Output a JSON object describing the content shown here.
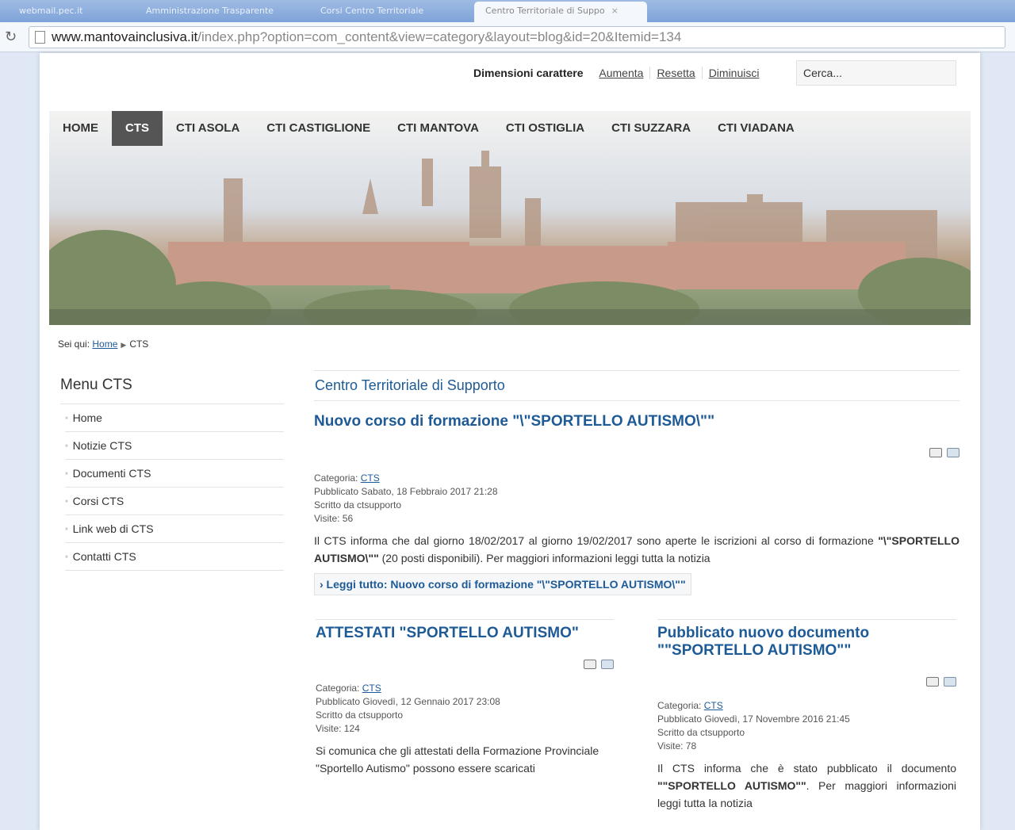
{
  "browser": {
    "tabs": [
      {
        "label": "webmail.pec.it"
      },
      {
        "label": "Amministrazione Trasparente"
      },
      {
        "label": "Corsi Centro Territoriale"
      },
      {
        "label": "Centro Territoriale di Suppo",
        "close": "×"
      }
    ],
    "url_host": "www.mantovainclusiva.it",
    "url_rest": "/index.php?option=com_content&view=category&layout=blog&id=20&Itemid=134"
  },
  "font_controls": {
    "label": "Dimensioni carattere",
    "increase": "Aumenta",
    "reset": "Resetta",
    "decrease": "Diminuisci"
  },
  "search": {
    "placeholder": "Cerca..."
  },
  "nav": {
    "items": [
      "HOME",
      "CTS",
      "CTI ASOLA",
      "CTI CASTIGLIONE",
      "CTI MANTOVA",
      "CTI OSTIGLIA",
      "CTI SUZZARA",
      "CTI VIADANA"
    ],
    "active": "CTS"
  },
  "breadcrumb": {
    "prefix": "Sei qui:",
    "home": "Home",
    "current": "CTS"
  },
  "sidebar": {
    "title": "Menu CTS",
    "items": [
      "Home",
      "Notizie CTS",
      "Documenti CTS",
      "Corsi CTS",
      "Link web di CTS",
      "Contatti CTS"
    ]
  },
  "main": {
    "category_title": "Centro Territoriale di Supporto",
    "lead": {
      "title": "Nuovo corso di formazione \"\\\"SPORTELLO AUTISMO\\\"\"",
      "category_label": "Categoria:",
      "category": "CTS",
      "published": "Pubblicato Sabato, 18 Febbraio 2017 21:28",
      "author": "Scritto da ctsupporto",
      "visits": "Visite: 56",
      "body_a": "Il CTS informa che dal giorno 18/02/2017 al giorno 19/02/2017 sono aperte le iscrizioni al corso di formazione ",
      "body_bold": "\"\\\"SPORTELLO AUTISMO\\\"\"",
      "body_b": " (20 posti disponibili). Per maggiori informazioni leggi tutta la notizia",
      "readmore": "› Leggi tutto: Nuovo corso di formazione \"\\\"SPORTELLO AUTISMO\\\"\""
    },
    "left": {
      "title": "ATTESTATI \"SPORTELLO AUTISMO\"",
      "category_label": "Categoria:",
      "category": "CTS",
      "published": "Pubblicato Giovedì, 12 Gennaio 2017 23:08",
      "author": "Scritto da ctsupporto",
      "visits": "Visite: 124",
      "body": "Si comunica che gli attestati della Formazione Provinciale \"Sportello Autismo\" possono essere scaricati"
    },
    "right": {
      "title": "Pubblicato nuovo documento \"\"SPORTELLO AUTISMO\"\"",
      "category_label": "Categoria:",
      "category": "CTS",
      "published": "Pubblicato Giovedì, 17 Novembre 2016 21:45",
      "author": "Scritto da ctsupporto",
      "visits": "Visite: 78",
      "body_a": "Il CTS informa che è stato pubblicato il documento ",
      "body_bold": "\"\"SPORTELLO AUTISMO\"\"",
      "body_b": ". Per maggiori informazioni leggi tutta la notizia"
    }
  }
}
